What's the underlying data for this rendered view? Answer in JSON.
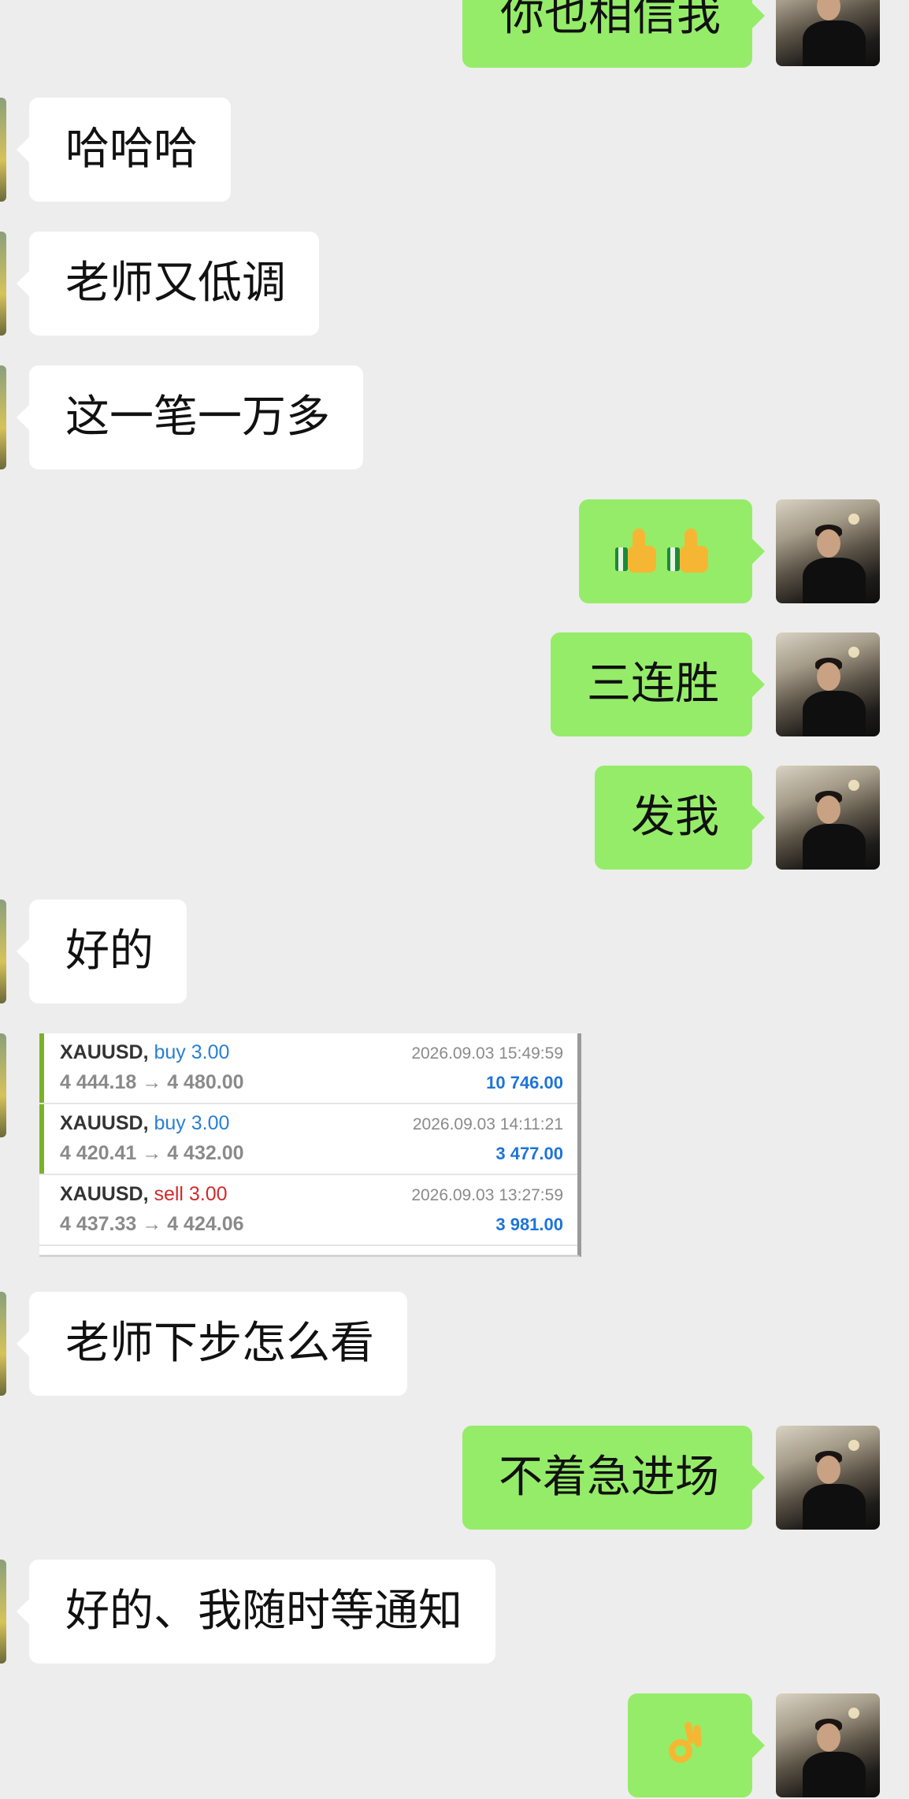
{
  "messages": {
    "m0": "你也相信我",
    "m1": "哈哈哈",
    "m2": "老师又低调",
    "m3": "这一笔一万多",
    "m5": "三连胜",
    "m6": "发我",
    "m7": "好的",
    "m9": "老师下步怎么看",
    "m10": "不着急进场",
    "m11": "好的、我随时等通知"
  },
  "trades": [
    {
      "symbol": "XAUUSD,",
      "direction": "buy 3.00",
      "prices": "4 444.18 → 4 480.00",
      "time": "2026.09.03 15:49:59",
      "profit": "10 746.00"
    },
    {
      "symbol": "XAUUSD,",
      "direction": "buy 3.00",
      "prices": "4 420.41 → 4 432.00",
      "time": "2026.09.03 14:11:21",
      "profit": "3 477.00"
    },
    {
      "symbol": "XAUUSD,",
      "direction": "sell 3.00",
      "prices": "4 437.33 → 4 424.06",
      "time": "2026.09.03 13:27:59",
      "profit": "3 981.00"
    }
  ],
  "colors": {
    "background": "#ededed",
    "outgoing_bubble": "#95ec69",
    "incoming_bubble": "#ffffff",
    "buy": "#2a7fd4",
    "sell": "#d42a2a",
    "profit": "#1e74d8",
    "win_bar": "#7bb22a"
  },
  "icons": {
    "thumbs_up": "thumbs-up-icon",
    "ok_hand": "ok-hand-icon"
  }
}
